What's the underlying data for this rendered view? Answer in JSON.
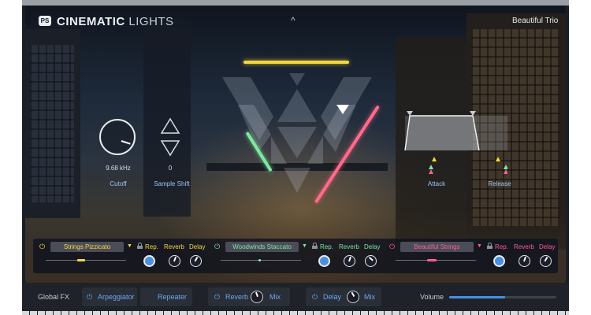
{
  "header": {
    "logo_text": "PS",
    "title_bold": "CINEMATIC",
    "title_light": " LIGHTS",
    "collapse_glyph": "^",
    "preset_name": "Beautiful Trio"
  },
  "controls": {
    "cutoff": {
      "value": "9.68 kHz",
      "label": "Cutoff",
      "knob_level": 0.7
    },
    "sample_shift": {
      "value": "0",
      "label": "Sample Shift"
    },
    "attack": {
      "label": "Attack"
    },
    "release": {
      "label": "Release"
    }
  },
  "instruments": [
    {
      "name": "Strings Pizzicato",
      "accent": "#f5d83a",
      "power_color": "#f5d83a",
      "rep": "Rep.",
      "reverb": "Reverb",
      "delay": "Delay",
      "level": 0.4
    },
    {
      "name": "Woodwinds Staccato",
      "accent": "#7de8a0",
      "power_color": "#7de8a0",
      "rep": "Rep.",
      "reverb": "Reverb",
      "delay": "Delay",
      "level": 0.45
    },
    {
      "name": "Beautiful Strings",
      "accent": "#ff5c96",
      "power_color": "#ff5c96",
      "rep": "Rep.",
      "reverb": "Reverb",
      "delay": "Delay",
      "level": 0.5
    }
  ],
  "global_fx": {
    "label": "Global FX",
    "arpeggiator": "Arpeggiator",
    "repeater": "Repeater",
    "reverb": "Reverb",
    "reverb_mix": "Mix",
    "delay": "Delay",
    "delay_mix": "Mix",
    "volume_label": "Volume",
    "volume_level": 0.52
  },
  "colors": {
    "accent_blue": "#4a90e2",
    "label_blue": "#9cc4f0"
  }
}
